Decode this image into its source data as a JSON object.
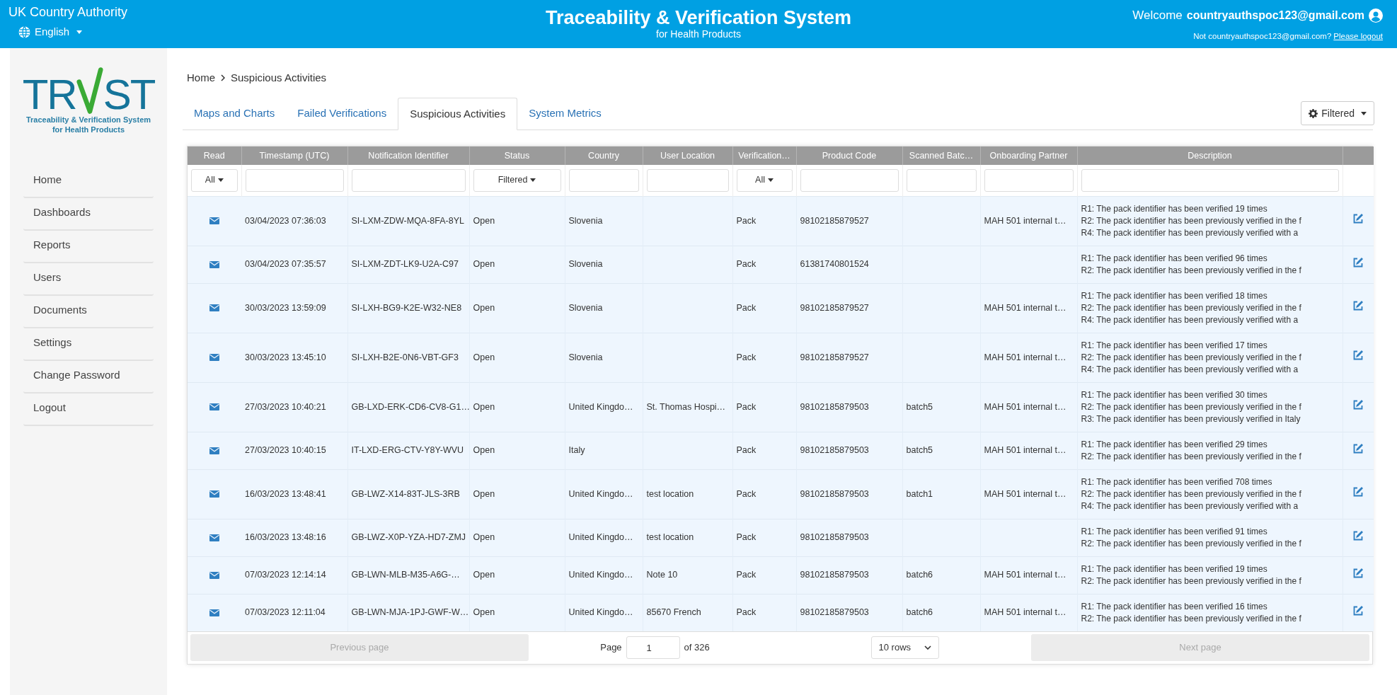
{
  "header": {
    "authority": "UK Country Authority",
    "language": "English",
    "title": "Traceability & Verification System",
    "subtitle": "for Health Products",
    "welcome": "Welcome",
    "user": "countryauthspoc123@gmail.com",
    "not_user": "Not countryauthspoc123@gmail.com?",
    "logout_link": "Please logout"
  },
  "logo": {
    "left": "TR",
    "right": "ST",
    "tagline": [
      "Traceability & Verification System",
      "for Health Products"
    ]
  },
  "sidebar": {
    "items": [
      "Home",
      "Dashboards",
      "Reports",
      "Users",
      "Documents",
      "Settings",
      "Change Password",
      "Logout"
    ]
  },
  "breadcrumb": [
    "Home",
    "Suspicious Activities"
  ],
  "tabs": [
    {
      "label": "Maps and Charts",
      "selected": false
    },
    {
      "label": "Failed Verifications",
      "selected": false
    },
    {
      "label": "Suspicious Activities",
      "selected": true
    },
    {
      "label": "System Metrics",
      "selected": false
    }
  ],
  "filter_button": "Filtered",
  "table": {
    "columns": [
      {
        "label": "Read",
        "filter": {
          "kind": "select",
          "value": "All"
        }
      },
      {
        "label": "Timestamp (UTC)",
        "filter": {
          "kind": "text"
        }
      },
      {
        "label": "Notification Identifier",
        "filter": {
          "kind": "text"
        }
      },
      {
        "label": "Status",
        "filter": {
          "kind": "select",
          "value": "Filtered"
        }
      },
      {
        "label": "Country",
        "filter": {
          "kind": "text"
        }
      },
      {
        "label": "User Location",
        "filter": {
          "kind": "text"
        }
      },
      {
        "label": "Verification…",
        "filter": {
          "kind": "select",
          "value": "All"
        }
      },
      {
        "label": "Product Code",
        "filter": {
          "kind": "text"
        }
      },
      {
        "label": "Scanned Batc…",
        "filter": {
          "kind": "text"
        }
      },
      {
        "label": "Onboarding Partner",
        "filter": {
          "kind": "text"
        }
      },
      {
        "label": "Description",
        "filter": {
          "kind": "text"
        }
      }
    ],
    "rows": [
      {
        "timestamp": "03/04/2023 07:36:03",
        "notification_id": "SI-LXM-ZDW-MQA-8FA-8YL",
        "status": "Open",
        "country": "Slovenia",
        "user_location": "",
        "verification": "Pack",
        "product_code": "98102185879527",
        "scanned_batch": "",
        "onboarding_partner": "MAH 501 internal t…",
        "description": [
          "R1: The pack identifier has been verified 19 times",
          "R2: The pack identifier has been previously verified in the f",
          "R4: The pack identifier has been previously verified with a"
        ]
      },
      {
        "timestamp": "03/04/2023 07:35:57",
        "notification_id": "SI-LXM-ZDT-LK9-U2A-C97",
        "status": "Open",
        "country": "Slovenia",
        "user_location": "",
        "verification": "Pack",
        "product_code": "61381740801524",
        "scanned_batch": "",
        "onboarding_partner": "",
        "description": [
          "R1: The pack identifier has been verified 96 times",
          "R2: The pack identifier has been previously verified in the f"
        ]
      },
      {
        "timestamp": "30/03/2023 13:59:09",
        "notification_id": "SI-LXH-BG9-K2E-W32-NE8",
        "status": "Open",
        "country": "Slovenia",
        "user_location": "",
        "verification": "Pack",
        "product_code": "98102185879527",
        "scanned_batch": "",
        "onboarding_partner": "MAH 501 internal t…",
        "description": [
          "R1: The pack identifier has been verified 18 times",
          "R2: The pack identifier has been previously verified in the f",
          "R4: The pack identifier has been previously verified with a"
        ]
      },
      {
        "timestamp": "30/03/2023 13:45:10",
        "notification_id": "SI-LXH-B2E-0N6-VBT-GF3",
        "status": "Open",
        "country": "Slovenia",
        "user_location": "",
        "verification": "Pack",
        "product_code": "98102185879527",
        "scanned_batch": "",
        "onboarding_partner": "MAH 501 internal t…",
        "description": [
          "R1: The pack identifier has been verified 17 times",
          "R2: The pack identifier has been previously verified in the f",
          "R4: The pack identifier has been previously verified with a"
        ]
      },
      {
        "timestamp": "27/03/2023 10:40:21",
        "notification_id": "GB-LXD-ERK-CD6-CV8-G1…",
        "status": "Open",
        "country": "United Kingdo…",
        "user_location": "St. Thomas Hospi…",
        "verification": "Pack",
        "product_code": "98102185879503",
        "scanned_batch": "batch5",
        "onboarding_partner": "MAH 501 internal t…",
        "description": [
          "R1: The pack identifier has been verified 30 times",
          "R2: The pack identifier has been previously verified in the f",
          "R3: The pack identifier has been previously verified in Italy"
        ]
      },
      {
        "timestamp": "27/03/2023 10:40:15",
        "notification_id": "IT-LXD-ERG-CTV-Y8Y-WVU",
        "status": "Open",
        "country": "Italy",
        "user_location": "",
        "verification": "Pack",
        "product_code": "98102185879503",
        "scanned_batch": "batch5",
        "onboarding_partner": "MAH 501 internal t…",
        "description": [
          "R1: The pack identifier has been verified 29 times",
          "R2: The pack identifier has been previously verified in the f"
        ]
      },
      {
        "timestamp": "16/03/2023 13:48:41",
        "notification_id": "GB-LWZ-X14-83T-JLS-3RB",
        "status": "Open",
        "country": "United Kingdo…",
        "user_location": "test location",
        "verification": "Pack",
        "product_code": "98102185879503",
        "scanned_batch": "batch1",
        "onboarding_partner": "MAH 501 internal t…",
        "description": [
          "R1: The pack identifier has been verified 708 times",
          "R2: The pack identifier has been previously verified in the f",
          "R4: The pack identifier has been previously verified with a"
        ]
      },
      {
        "timestamp": "16/03/2023 13:48:16",
        "notification_id": "GB-LWZ-X0P-YZA-HD7-ZMJ",
        "status": "Open",
        "country": "United Kingdo…",
        "user_location": "test location",
        "verification": "Pack",
        "product_code": "98102185879503",
        "scanned_batch": "",
        "onboarding_partner": "",
        "description": [
          "R1: The pack identifier has been verified 91 times",
          "R2: The pack identifier has been previously verified in the f"
        ]
      },
      {
        "timestamp": "07/03/2023 12:14:14",
        "notification_id": "GB-LWN-MLB-M35-A6G-…",
        "status": "Open",
        "country": "United Kingdo…",
        "user_location": "Note 10",
        "verification": "Pack",
        "product_code": "98102185879503",
        "scanned_batch": "batch6",
        "onboarding_partner": "MAH 501 internal t…",
        "description": [
          "R1: The pack identifier has been verified 19 times",
          "R2: The pack identifier has been previously verified in the f"
        ]
      },
      {
        "timestamp": "07/03/2023 12:11:04",
        "notification_id": "GB-LWN-MJA-1PJ-GWF-W…",
        "status": "Open",
        "country": "United Kingdo…",
        "user_location": "85670 French",
        "verification": "Pack",
        "product_code": "98102185879503",
        "scanned_batch": "batch6",
        "onboarding_partner": "MAH 501 internal t…",
        "description": [
          "R1: The pack identifier has been verified 16 times",
          "R2: The pack identifier has been previously verified in the f"
        ]
      }
    ]
  },
  "pagination": {
    "previous": {
      "label": "Previous page",
      "disabled": true
    },
    "page_label": "Page",
    "page_value": "1",
    "of_label": "of 326",
    "rows_select": "10 rows",
    "next": {
      "label": "Next page",
      "disabled": true
    }
  }
}
